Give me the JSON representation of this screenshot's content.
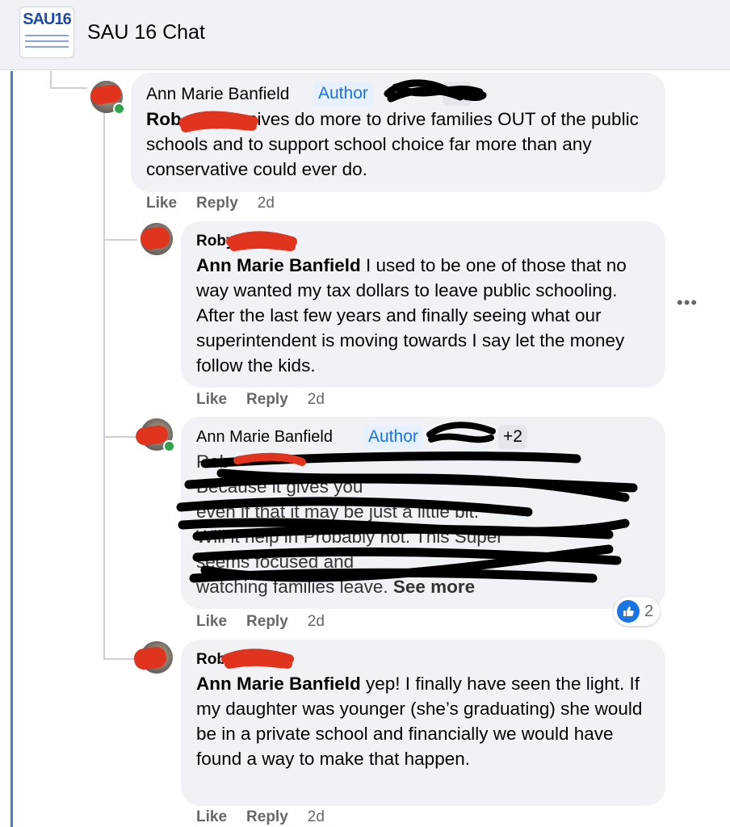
{
  "header": {
    "title": "SAU 16 Chat",
    "logo_text": "SAU16"
  },
  "comments": [
    {
      "name": "Ann Marie Banfield",
      "badge": "Author",
      "extra_badge": "+2",
      "mention": "Rob",
      "text": " progressives do more to drive families OUT of the public schools and to support school choice far more than any conservative could ever do.",
      "like": "Like",
      "reply": "Reply",
      "time": "2d"
    },
    {
      "name": "Roby",
      "mention": "Ann Marie Banfield",
      "text": " I used to be one of those that no way wanted my tax dollars to leave public schooling. After the last few years and finally seeing what our superintendent is moving towards I say let the money follow the kids.",
      "like": "Like",
      "reply": "Reply",
      "time": "2d"
    },
    {
      "name": "Ann Marie Banfield",
      "badge": "Author",
      "extra_badge": "+2",
      "obscured_lines": [
        "Rob",
        "Because it gives you",
        "even if that it may be just a little bit.",
        "Will it help in",
        "Probably not. This Super",
        "seems focused",
        "and",
        "watching families leave.",
        "See more"
      ],
      "like": "Like",
      "reply": "Reply",
      "time": "2d",
      "reaction_count": "2"
    },
    {
      "name": "Roby",
      "mention": "Ann Marie Banfield",
      "text": " yep! I finally have seen the light. If my daughter was younger (she’s graduating) she would be in a private school and financially we would have found a way to make that happen.",
      "like": "Like",
      "reply": "Reply",
      "time": "2d"
    }
  ],
  "more_options": "•••",
  "icons": {
    "like": "thumbs-up-icon",
    "more": "more-options-icon"
  },
  "colors": {
    "accent": "#1b74e4",
    "bubble": "#f0f2f5",
    "scribble": "#000000",
    "redaction": "#e0341f"
  }
}
